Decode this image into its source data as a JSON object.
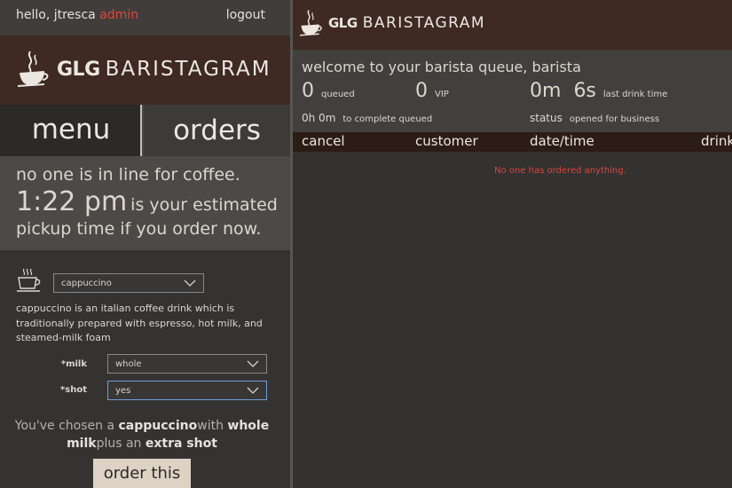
{
  "user": {
    "greeting": "hello, jtresca",
    "role": "admin",
    "logout_label": "logout"
  },
  "brand": {
    "glg": "GLG",
    "name": "BARISTAGRAM"
  },
  "tabs": {
    "menu_label": "menu",
    "orders_label": "orders"
  },
  "status": {
    "line_empty": "no one is in line for coffee.",
    "pickup_time": "1:22 pm",
    "estimated_text": "is your estimated",
    "pickup_text": "pickup time  if you order now."
  },
  "order_form": {
    "drink_icon": "coffee-cup-icon",
    "drink_value": "cappuccino",
    "description": "cappuccino is an italian coffee drink which is traditionally prepared with espresso, hot milk, and steamed-milk foam",
    "milk_label": "*milk",
    "milk_value": "whole",
    "shot_label": "*shot",
    "shot_value": "yes",
    "summary_1": "You've chosen a ",
    "summary_drink": "cappuccino",
    "summary_2": "with ",
    "summary_milk": "whole milk",
    "summary_3": "plus an ",
    "summary_shot": "extra shot",
    "order_button": "order this"
  },
  "queue": {
    "welcome": "welcome to your barista queue, barista",
    "queued_count": "0",
    "queued_label": "queued",
    "vip_count": "0",
    "vip_label": "VIP",
    "last_min": "0m",
    "last_sec": "6s",
    "last_label": "last drink time",
    "complete_time": "0h 0m",
    "complete_label": "to complete queued",
    "status_label": "status",
    "status_value": "opened for business",
    "columns": [
      "cancel",
      "customer",
      "date/time",
      "drink"
    ],
    "empty_message": "No one has ordered anything."
  },
  "colors": {
    "brand_bg": "#3e2a22",
    "accent_red": "#e0453f",
    "order_button_bg": "#ddd2c4",
    "focus_border": "#6f9cd6"
  }
}
